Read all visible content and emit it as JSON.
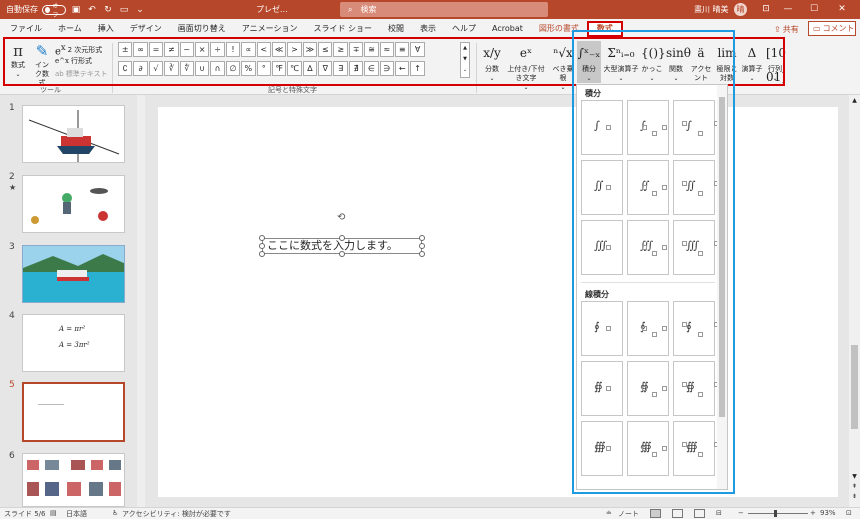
{
  "titlebar": {
    "autosave_label": "自動保存",
    "autosave_state": "オフ",
    "doc_title": "プレゼ...",
    "search_placeholder": "検索",
    "user_name": "晝川 晴美",
    "avatar_initial": "晴"
  },
  "tabs": [
    "ファイル",
    "ホーム",
    "挿入",
    "デザイン",
    "画面切り替え",
    "アニメーション",
    "スライド ショー",
    "校閲",
    "表示",
    "ヘルプ",
    "Acrobat",
    "図形の書式",
    "数式"
  ],
  "active_tab_index": 12,
  "context_tab_index": 11,
  "share_label": "共有",
  "comment_label": "コメント",
  "ribbon": {
    "tools_group_label": "ツール",
    "symbols_group_label": "記号と特殊文字",
    "equation_button": "数式",
    "ink_equation_button": "インク数式",
    "professional_button": "2 次元形式",
    "linear_button": "行形式",
    "normal_text_button": "標準テキスト",
    "symbols_row1": [
      "±",
      "∞",
      "=",
      "≠",
      "~",
      "×",
      "÷",
      "!",
      "∝",
      "<",
      "≪",
      ">",
      "≫",
      "≤",
      "≥",
      "∓",
      "≅",
      "≈",
      "≡",
      "∀"
    ],
    "symbols_row2": [
      "∁",
      "∂",
      "√",
      "∛",
      "∜",
      "∪",
      "∩",
      "∅",
      "%",
      "°",
      "℉",
      "℃",
      "∆",
      "∇",
      "∃",
      "∄",
      "∈",
      "∋",
      "←",
      "↑"
    ],
    "structures": [
      {
        "icon": "x/y",
        "label": "分数"
      },
      {
        "icon": "eˣ",
        "label": "上付き/下付き文字"
      },
      {
        "icon": "ⁿ√x",
        "label": "べき乗根"
      },
      {
        "icon": "∫ˣ₋ₓ",
        "label": "積分"
      },
      {
        "icon": "Σⁿᵢ₌₀",
        "label": "大型演算子"
      },
      {
        "icon": "{()}",
        "label": "かっこ"
      },
      {
        "icon": "sinθ",
        "label": "関数"
      },
      {
        "icon": "ä",
        "label": "アクセント"
      },
      {
        "icon": "lim",
        "label": "極限と対数"
      },
      {
        "icon": "Δ",
        "label": "演算子"
      },
      {
        "icon": "[10 01]",
        "label": "行列"
      }
    ]
  },
  "gallery": {
    "integrals_header": "積分",
    "contour_header": "線積分",
    "integrals": [
      "∫",
      "∫",
      "∫",
      "∬",
      "∬",
      "∬",
      "∭",
      "∭",
      "∭"
    ],
    "contour_integrals": [
      "∮",
      "∮",
      "∮",
      "∯",
      "∯",
      "∯",
      "∰",
      "∰",
      "∰"
    ]
  },
  "thumbnails": [
    {
      "num": "1",
      "type": "boat"
    },
    {
      "num": "2",
      "star": "★",
      "type": "figures"
    },
    {
      "num": "3",
      "type": "photo"
    },
    {
      "num": "4",
      "type": "equations",
      "eq1": "A = πr²",
      "eq2": "A = 3πr²"
    },
    {
      "num": "5",
      "type": "blank",
      "selected": true
    },
    {
      "num": "6",
      "type": "grid"
    }
  ],
  "slide": {
    "equation_placeholder": "ここに数式を入力します。"
  },
  "statusbar": {
    "slide_info": "スライド 5/6",
    "language": "日本語",
    "accessibility": "アクセシビリティ: 検討が必要です",
    "notes_label": "ノート",
    "zoom": "93%"
  },
  "colors": {
    "accent": "#b7472a",
    "highlight_red": "#d40000",
    "highlight_blue": "#1e9be0"
  }
}
